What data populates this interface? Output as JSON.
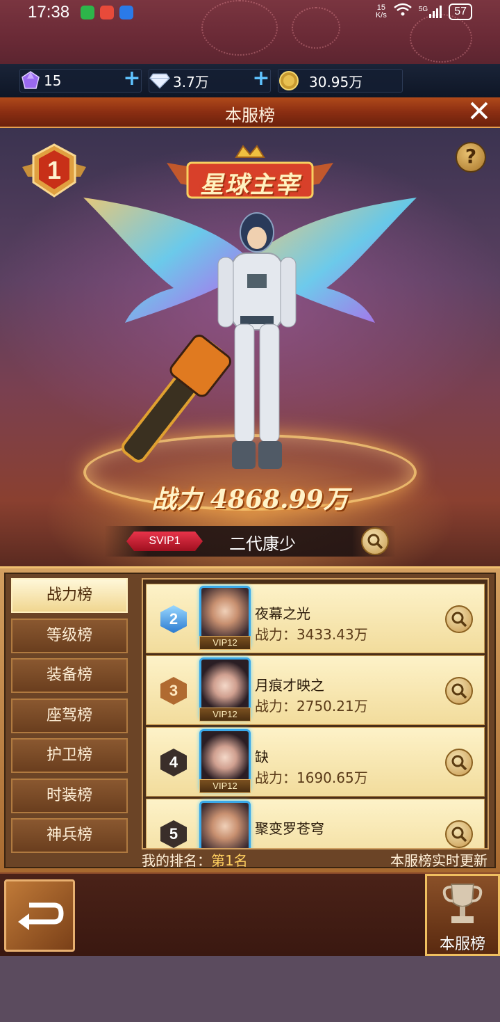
{
  "status_bar": {
    "time": "17:38",
    "net_speed": "15\nK/s",
    "signal": "5G",
    "battery": "57"
  },
  "currency": [
    {
      "icon": "purple-gem-icon",
      "value": "15"
    },
    {
      "icon": "diamond-icon",
      "value": "3.7万"
    },
    {
      "icon": "gold-coin-icon",
      "value": "30.95万"
    }
  ],
  "header": {
    "title": "本服榜"
  },
  "champion": {
    "rank": "1",
    "title_banner": "星球主宰",
    "power": "战力 4868.99万",
    "vip": "SVIP1",
    "name": "二代康少"
  },
  "tabs": [
    "战力榜",
    "等级榜",
    "装备榜",
    "座驾榜",
    "护卫榜",
    "时装榜",
    "神兵榜"
  ],
  "active_tab": 0,
  "rows": [
    {
      "rank": "2",
      "name": "夜幕之光",
      "power": "战力：3433.43万",
      "vip": "VIP12"
    },
    {
      "rank": "3",
      "name": "月痕才映之",
      "power": "战力：2750.21万",
      "vip": "VIP12"
    },
    {
      "rank": "4",
      "name": "缺",
      "power": "战力：1690.65万",
      "vip": "VIP12"
    },
    {
      "rank": "5",
      "name": "聚变罗苍穹",
      "power": "",
      "vip": ""
    }
  ],
  "footer": {
    "my_rank_label": "我的排名：",
    "my_rank_value": "第1名",
    "realtime": "本服榜实时更新",
    "trophy_label": "本服榜"
  },
  "colors": {
    "accent": "#f0c060",
    "active_tab_bg": "#fff7d8",
    "vip_red": "#e8344a"
  }
}
